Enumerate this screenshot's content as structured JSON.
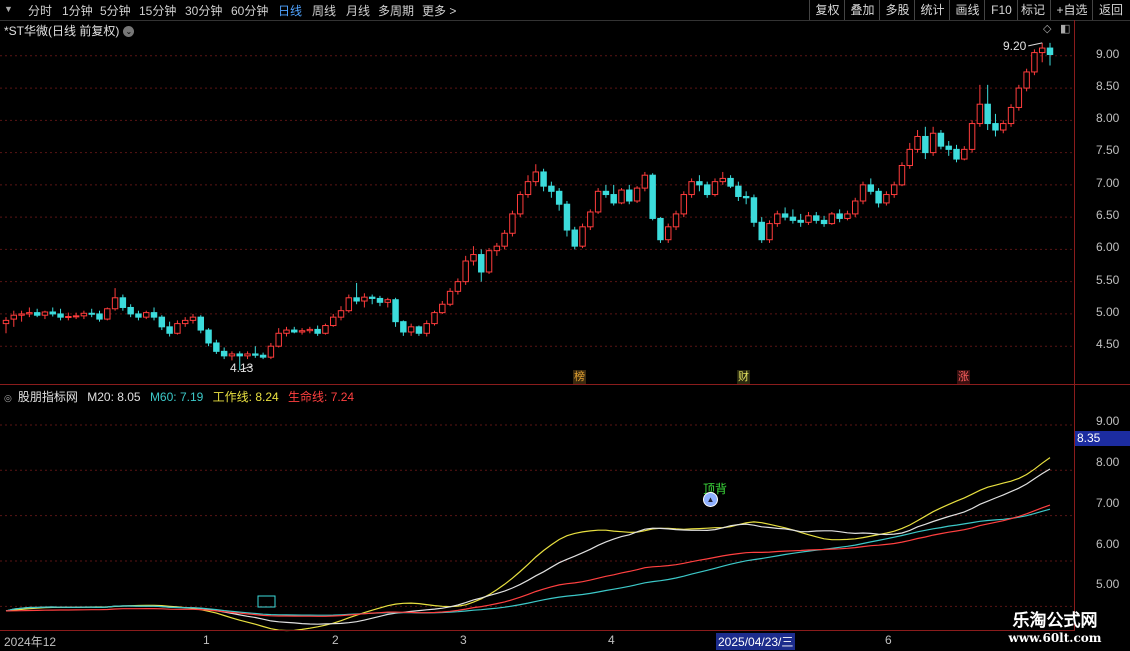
{
  "toolbar": {
    "timeframes": [
      "分时",
      "1分钟",
      "5分钟",
      "15分钟",
      "30分钟",
      "60分钟",
      "日线",
      "周线",
      "月线",
      "多周期",
      "更多 >"
    ],
    "active": "日线",
    "right_buttons": [
      "复权",
      "叠加",
      "多股",
      "统计",
      "画线",
      "F10",
      "+自选",
      "返回"
    ],
    "mark_button": "标记"
  },
  "main_chart": {
    "title": "*ST华微(日线 前复权)",
    "max_label": "9.20",
    "min_label": "4.13",
    "price_axis": [
      "9.00",
      "8.50",
      "8.00",
      "7.50",
      "7.00",
      "6.50",
      "6.00",
      "5.50",
      "5.00",
      "4.50"
    ],
    "events": [
      {
        "text": "榜",
        "color": "#e0a030"
      },
      {
        "text": "财",
        "color": "#e0e060"
      },
      {
        "text": "涨",
        "color": "#ff6060"
      }
    ]
  },
  "indicator": {
    "name": "股朋指标网",
    "labels": [
      {
        "text": "M20: 8.05",
        "color": "#e0e0e0"
      },
      {
        "text": "M60: 7.19",
        "color": "#3cc8c8"
      },
      {
        "text": "工作线: 8.24",
        "color": "#e8e040"
      },
      {
        "text": "生命线: 7.24",
        "color": "#ff4040"
      }
    ],
    "axis": [
      "9.00",
      "8.00",
      "7.00",
      "6.00",
      "5.00"
    ],
    "current_value": "8.35",
    "signal_label": "顶背"
  },
  "date_axis": {
    "labels": [
      "2024年12",
      "1",
      "2",
      "3",
      "4",
      "2025/04/23/三",
      "6"
    ],
    "highlight": "2025/04/23/三"
  },
  "watermark": {
    "line1": "乐淘公式网",
    "line2": "www.60lt.com"
  },
  "chart_data": {
    "type": "candlestick",
    "series_note": "daily OHLC, *ST华微, Dec 2024 - Jun 2025",
    "candles": [
      [
        4.85,
        4.95,
        4.7,
        4.9
      ],
      [
        4.92,
        5.05,
        4.8,
        4.98
      ],
      [
        4.98,
        5.05,
        4.88,
        5.0
      ],
      [
        5.0,
        5.1,
        4.95,
        5.02
      ],
      [
        5.02,
        5.08,
        4.95,
        4.98
      ],
      [
        4.98,
        5.05,
        4.92,
        5.03
      ],
      [
        5.03,
        5.1,
        4.96,
        5.0
      ],
      [
        5.0,
        5.08,
        4.9,
        4.95
      ],
      [
        4.95,
        5.02,
        4.9,
        4.96
      ],
      [
        4.96,
        5.02,
        4.92,
        4.97
      ],
      [
        4.97,
        5.05,
        4.92,
        5.01
      ],
      [
        5.01,
        5.08,
        4.95,
        5.0
      ],
      [
        5.0,
        5.05,
        4.88,
        4.92
      ],
      [
        4.92,
        5.1,
        4.9,
        5.08
      ],
      [
        5.08,
        5.4,
        5.05,
        5.25
      ],
      [
        5.25,
        5.3,
        5.05,
        5.1
      ],
      [
        5.1,
        5.15,
        4.95,
        5.0
      ],
      [
        5.0,
        5.05,
        4.9,
        4.95
      ],
      [
        4.95,
        5.05,
        4.92,
        5.02
      ],
      [
        5.02,
        5.1,
        4.9,
        4.95
      ],
      [
        4.95,
        4.98,
        4.75,
        4.8
      ],
      [
        4.8,
        4.88,
        4.65,
        4.7
      ],
      [
        4.7,
        4.9,
        4.68,
        4.85
      ],
      [
        4.85,
        4.95,
        4.8,
        4.9
      ],
      [
        4.9,
        5.0,
        4.85,
        4.95
      ],
      [
        4.95,
        4.98,
        4.7,
        4.75
      ],
      [
        4.75,
        4.78,
        4.5,
        4.55
      ],
      [
        4.55,
        4.6,
        4.38,
        4.42
      ],
      [
        4.42,
        4.48,
        4.3,
        4.35
      ],
      [
        4.35,
        4.42,
        4.28,
        4.38
      ],
      [
        4.38,
        4.42,
        4.13,
        4.35
      ],
      [
        4.35,
        4.42,
        4.3,
        4.38
      ],
      [
        4.38,
        4.5,
        4.32,
        4.36
      ],
      [
        4.36,
        4.4,
        4.3,
        4.33
      ],
      [
        4.33,
        4.55,
        4.3,
        4.5
      ],
      [
        4.5,
        4.78,
        4.48,
        4.7
      ],
      [
        4.7,
        4.8,
        4.65,
        4.75
      ],
      [
        4.75,
        4.8,
        4.7,
        4.72
      ],
      [
        4.72,
        4.78,
        4.68,
        4.74
      ],
      [
        4.74,
        4.8,
        4.7,
        4.76
      ],
      [
        4.76,
        4.82,
        4.66,
        4.7
      ],
      [
        4.7,
        4.85,
        4.68,
        4.82
      ],
      [
        4.82,
        5.0,
        4.8,
        4.95
      ],
      [
        4.95,
        5.12,
        4.9,
        5.05
      ],
      [
        5.05,
        5.3,
        5.02,
        5.25
      ],
      [
        5.25,
        5.48,
        5.15,
        5.2
      ],
      [
        5.2,
        5.32,
        5.1,
        5.26
      ],
      [
        5.26,
        5.3,
        5.15,
        5.24
      ],
      [
        5.24,
        5.28,
        5.12,
        5.18
      ],
      [
        5.18,
        5.25,
        5.1,
        5.22
      ],
      [
        5.22,
        5.25,
        4.8,
        4.88
      ],
      [
        4.88,
        4.9,
        4.66,
        4.72
      ],
      [
        4.72,
        4.85,
        4.66,
        4.8
      ],
      [
        4.8,
        4.82,
        4.66,
        4.7
      ],
      [
        4.7,
        4.9,
        4.65,
        4.85
      ],
      [
        4.85,
        5.05,
        4.82,
        5.02
      ],
      [
        5.02,
        5.2,
        5.0,
        5.15
      ],
      [
        5.15,
        5.4,
        5.12,
        5.35
      ],
      [
        5.35,
        5.55,
        5.3,
        5.5
      ],
      [
        5.5,
        5.9,
        5.45,
        5.82
      ],
      [
        5.82,
        6.05,
        5.75,
        5.92
      ],
      [
        5.92,
        6.0,
        5.5,
        5.65
      ],
      [
        5.65,
        6.02,
        5.62,
        5.98
      ],
      [
        5.98,
        6.1,
        5.9,
        6.05
      ],
      [
        6.05,
        6.3,
        6.0,
        6.25
      ],
      [
        6.25,
        6.6,
        6.2,
        6.55
      ],
      [
        6.55,
        6.9,
        6.5,
        6.85
      ],
      [
        6.85,
        7.15,
        6.8,
        7.05
      ],
      [
        7.05,
        7.32,
        6.98,
        7.2
      ],
      [
        7.2,
        7.25,
        6.9,
        6.98
      ],
      [
        6.98,
        7.05,
        6.8,
        6.9
      ],
      [
        6.9,
        6.95,
        6.6,
        6.7
      ],
      [
        6.7,
        6.75,
        6.2,
        6.3
      ],
      [
        6.3,
        6.35,
        6.0,
        6.05
      ],
      [
        6.05,
        6.4,
        6.02,
        6.35
      ],
      [
        6.35,
        6.62,
        6.3,
        6.58
      ],
      [
        6.58,
        6.95,
        6.55,
        6.9
      ],
      [
        6.9,
        7.0,
        6.8,
        6.85
      ],
      [
        6.85,
        7.0,
        6.68,
        6.72
      ],
      [
        6.72,
        6.95,
        6.7,
        6.92
      ],
      [
        6.92,
        7.0,
        6.7,
        6.75
      ],
      [
        6.75,
        6.98,
        6.72,
        6.95
      ],
      [
        6.95,
        7.2,
        6.9,
        7.15
      ],
      [
        7.15,
        7.18,
        6.45,
        6.48
      ],
      [
        6.48,
        6.5,
        6.1,
        6.15
      ],
      [
        6.15,
        6.4,
        6.1,
        6.35
      ],
      [
        6.35,
        6.6,
        6.3,
        6.55
      ],
      [
        6.55,
        6.9,
        6.5,
        6.85
      ],
      [
        6.85,
        7.1,
        6.8,
        7.05
      ],
      [
        7.05,
        7.15,
        6.9,
        7.0
      ],
      [
        7.0,
        7.05,
        6.8,
        6.85
      ],
      [
        6.85,
        7.1,
        6.82,
        7.05
      ],
      [
        7.05,
        7.2,
        7.0,
        7.1
      ],
      [
        7.1,
        7.15,
        6.95,
        6.98
      ],
      [
        6.98,
        7.05,
        6.75,
        6.82
      ],
      [
        6.82,
        6.9,
        6.7,
        6.8
      ],
      [
        6.8,
        6.85,
        6.35,
        6.42
      ],
      [
        6.42,
        6.5,
        6.1,
        6.15
      ],
      [
        6.15,
        6.45,
        6.1,
        6.4
      ],
      [
        6.4,
        6.6,
        6.35,
        6.55
      ],
      [
        6.55,
        6.65,
        6.45,
        6.5
      ],
      [
        6.5,
        6.62,
        6.4,
        6.45
      ],
      [
        6.45,
        6.55,
        6.35,
        6.42
      ],
      [
        6.42,
        6.58,
        6.38,
        6.52
      ],
      [
        6.52,
        6.58,
        6.4,
        6.45
      ],
      [
        6.45,
        6.52,
        6.35,
        6.4
      ],
      [
        6.4,
        6.58,
        6.38,
        6.55
      ],
      [
        6.55,
        6.62,
        6.42,
        6.48
      ],
      [
        6.48,
        6.6,
        6.45,
        6.55
      ],
      [
        6.55,
        6.8,
        6.5,
        6.75
      ],
      [
        6.75,
        7.05,
        6.7,
        7.0
      ],
      [
        7.0,
        7.1,
        6.85,
        6.9
      ],
      [
        6.9,
        6.95,
        6.65,
        6.72
      ],
      [
        6.72,
        6.9,
        6.68,
        6.85
      ],
      [
        6.85,
        7.05,
        6.8,
        7.0
      ],
      [
        7.0,
        7.35,
        6.98,
        7.3
      ],
      [
        7.3,
        7.65,
        7.25,
        7.55
      ],
      [
        7.55,
        7.85,
        7.5,
        7.75
      ],
      [
        7.75,
        7.9,
        7.4,
        7.5
      ],
      [
        7.5,
        7.9,
        7.45,
        7.8
      ],
      [
        7.8,
        7.85,
        7.55,
        7.6
      ],
      [
        7.6,
        7.68,
        7.45,
        7.55
      ],
      [
        7.55,
        7.62,
        7.35,
        7.4
      ],
      [
        7.4,
        7.6,
        7.38,
        7.55
      ],
      [
        7.55,
        8.0,
        7.5,
        7.95
      ],
      [
        7.95,
        8.55,
        7.9,
        8.25
      ],
      [
        8.25,
        8.55,
        7.85,
        7.95
      ],
      [
        7.95,
        8.1,
        7.75,
        7.85
      ],
      [
        7.85,
        8.0,
        7.8,
        7.95
      ],
      [
        7.95,
        8.25,
        7.9,
        8.2
      ],
      [
        8.2,
        8.55,
        8.15,
        8.5
      ],
      [
        8.5,
        8.8,
        8.45,
        8.75
      ],
      [
        8.75,
        9.1,
        8.7,
        9.05
      ],
      [
        9.05,
        9.2,
        8.9,
        9.12
      ],
      [
        9.12,
        9.2,
        8.85,
        9.02
      ]
    ],
    "indicator_series": [
      {
        "name": "M20",
        "color": "#e0e0e0"
      },
      {
        "name": "M60",
        "color": "#3cc8c8"
      },
      {
        "name": "工作线",
        "color": "#e8e040"
      },
      {
        "name": "生命线",
        "color": "#ff4040"
      }
    ],
    "price_range": [
      4.1,
      9.4
    ],
    "indicator_range": [
      4.7,
      9.55
    ]
  }
}
